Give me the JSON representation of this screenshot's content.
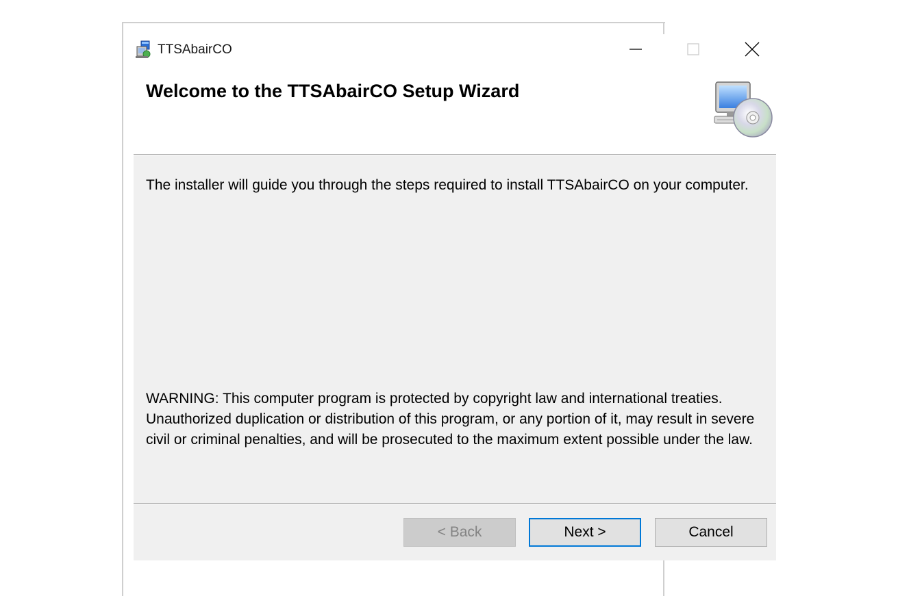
{
  "window": {
    "title": "TTSAbairCO"
  },
  "header": {
    "title": "Welcome to the TTSAbairCO Setup Wizard",
    "icon": "computer-cd-icon"
  },
  "body": {
    "intro": "The installer will guide you through the steps required to install TTSAbairCO on your computer.",
    "warning": "WARNING: This computer program is protected by copyright law and international treaties. Unauthorized duplication or distribution of this program, or any portion of it, may result in severe civil or criminal penalties, and will be prosecuted to the maximum extent possible under the law."
  },
  "footer": {
    "back_label": "< Back",
    "back_enabled": false,
    "next_label": "Next >",
    "cancel_label": "Cancel"
  },
  "colors": {
    "accent": "#0078d7",
    "panel_bg": "#f0f0f0",
    "disabled_text": "#838383"
  }
}
